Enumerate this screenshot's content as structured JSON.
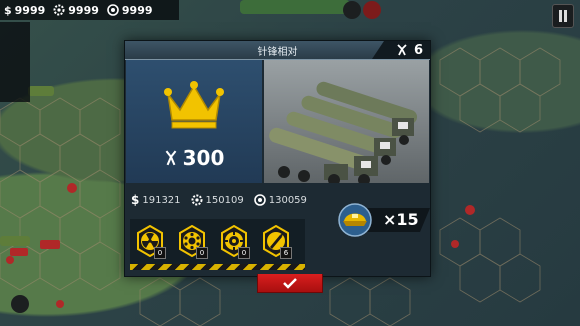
{
  "hud": {
    "resources": [
      {
        "icon": "dollar-icon",
        "value": "9999"
      },
      {
        "icon": "industry-gear-icon",
        "value": "9999"
      },
      {
        "icon": "oil-icon",
        "value": "9999"
      }
    ]
  },
  "dialog": {
    "title": "针锋相对",
    "medals": "6",
    "reward_medals": "300",
    "resources": [
      {
        "symbol": "$",
        "icon": "dollar-icon",
        "value": "191321"
      },
      {
        "icon": "industry-gear-icon",
        "value": "150109"
      },
      {
        "icon": "oil-icon",
        "value": "130059"
      }
    ],
    "cards": [
      {
        "icon": "nuclear-icon",
        "count": "0"
      },
      {
        "icon": "cluster-bomb-icon",
        "count": "0"
      },
      {
        "icon": "fuel-bomb-icon",
        "count": "0"
      },
      {
        "icon": "missile-strike-icon",
        "count": "6"
      }
    ],
    "generals": "×15",
    "confirm_icon": "checkmark-icon"
  },
  "colors": {
    "accent_gold": "#f2c300",
    "confirm_red": "#c41515",
    "panel_blue": "#2e4f6f"
  }
}
